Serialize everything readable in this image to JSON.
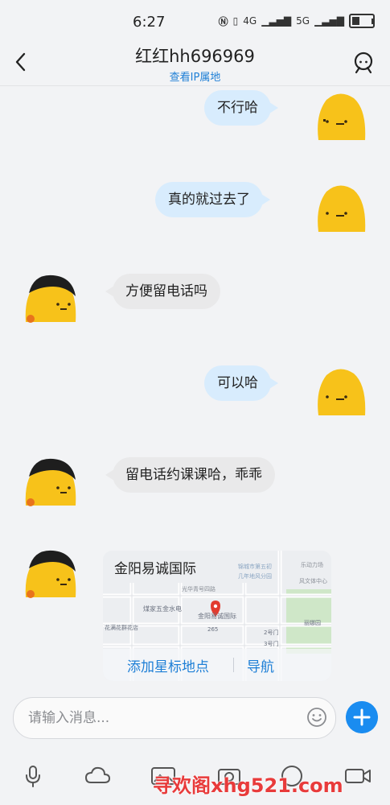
{
  "status": {
    "time": "6:27",
    "network": "4G",
    "network2": "5G"
  },
  "header": {
    "title": "红红hh696969",
    "subtitle": "查看IP属地"
  },
  "messages": [
    {
      "from": "me",
      "text": "不行哈"
    },
    {
      "from": "me",
      "text": "真的就过去了"
    },
    {
      "from": "other",
      "text": "方便留电话吗"
    },
    {
      "from": "me",
      "text": "可以哈"
    },
    {
      "from": "other",
      "text": "留电话约课课哈，乖乖"
    }
  ],
  "location": {
    "title": "金阳易诚国际",
    "action_star": "添加星标地点",
    "action_nav": "导航",
    "map_labels": [
      "煤家五金水电",
      "金阳易诚国际",
      "光华青号四路",
      "乐动力场",
      "风文体中心",
      "丽娜园",
      "锦城市第五初",
      "几年地风分园",
      "花满花群花店",
      "2号门",
      "3号门",
      "265"
    ]
  },
  "input": {
    "placeholder": "请输入消息..."
  },
  "watermark": "寻欢阁xhg521.com",
  "colors": {
    "accent": "#1a8cf0",
    "link": "#1e7fd6",
    "bubble_me": "#d8ecfd",
    "bubble_other": "#e9e9ea",
    "avatar_yellow": "#f7c21a"
  }
}
